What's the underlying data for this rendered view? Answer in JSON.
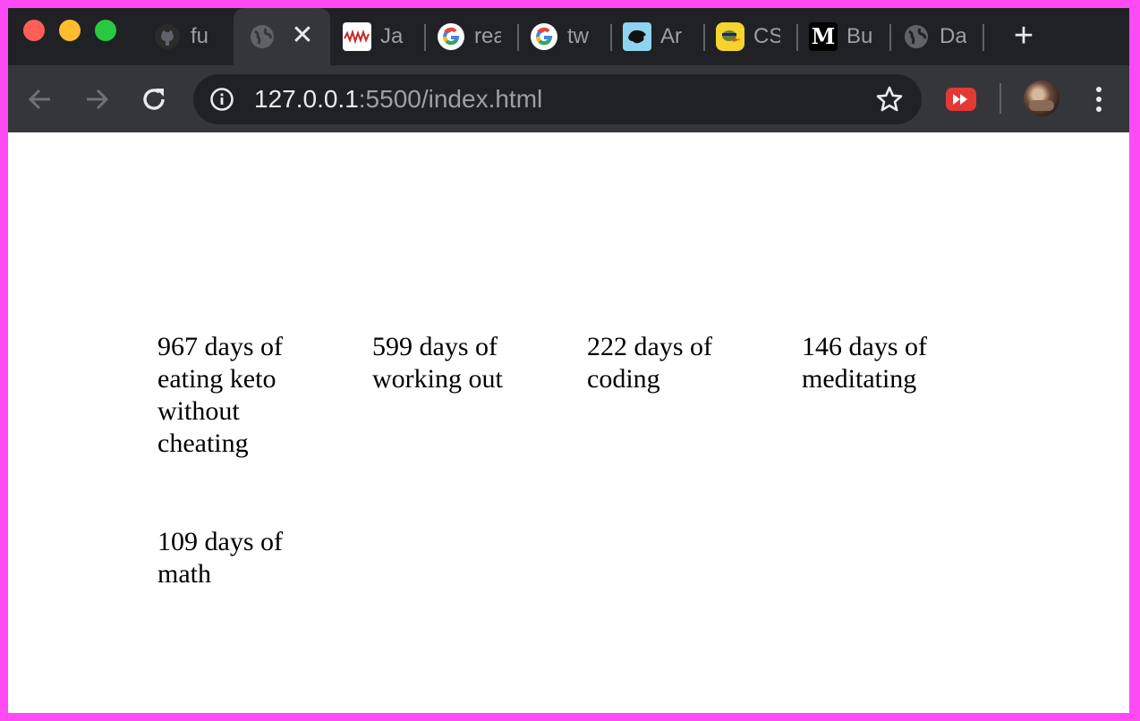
{
  "tabs": [
    {
      "title": "fu",
      "favicon": "github-icon"
    },
    {
      "title": "",
      "favicon": "globe-icon",
      "active": true
    },
    {
      "title": "Ja",
      "favicon": "red-pattern-icon"
    },
    {
      "title": "rea",
      "favicon": "google-icon"
    },
    {
      "title": "tw",
      "favicon": "google-icon"
    },
    {
      "title": "Ar",
      "favicon": "panther-icon"
    },
    {
      "title": "CS",
      "favicon": "duck-icon"
    },
    {
      "title": "Bu",
      "favicon": "medium-icon"
    },
    {
      "title": "Da",
      "favicon": "globe-icon"
    }
  ],
  "address_bar": {
    "host": "127.0.0.1",
    "path": ":5500/index.html"
  },
  "page": {
    "stats": [
      "967 days of eating keto without cheating",
      "599 days of working out",
      "222 days of coding",
      "146 days of meditating",
      "109 days of math"
    ]
  },
  "colors": {
    "frame": "#ff4af5",
    "tabstrip": "#202124",
    "toolbar": "#35363a"
  }
}
